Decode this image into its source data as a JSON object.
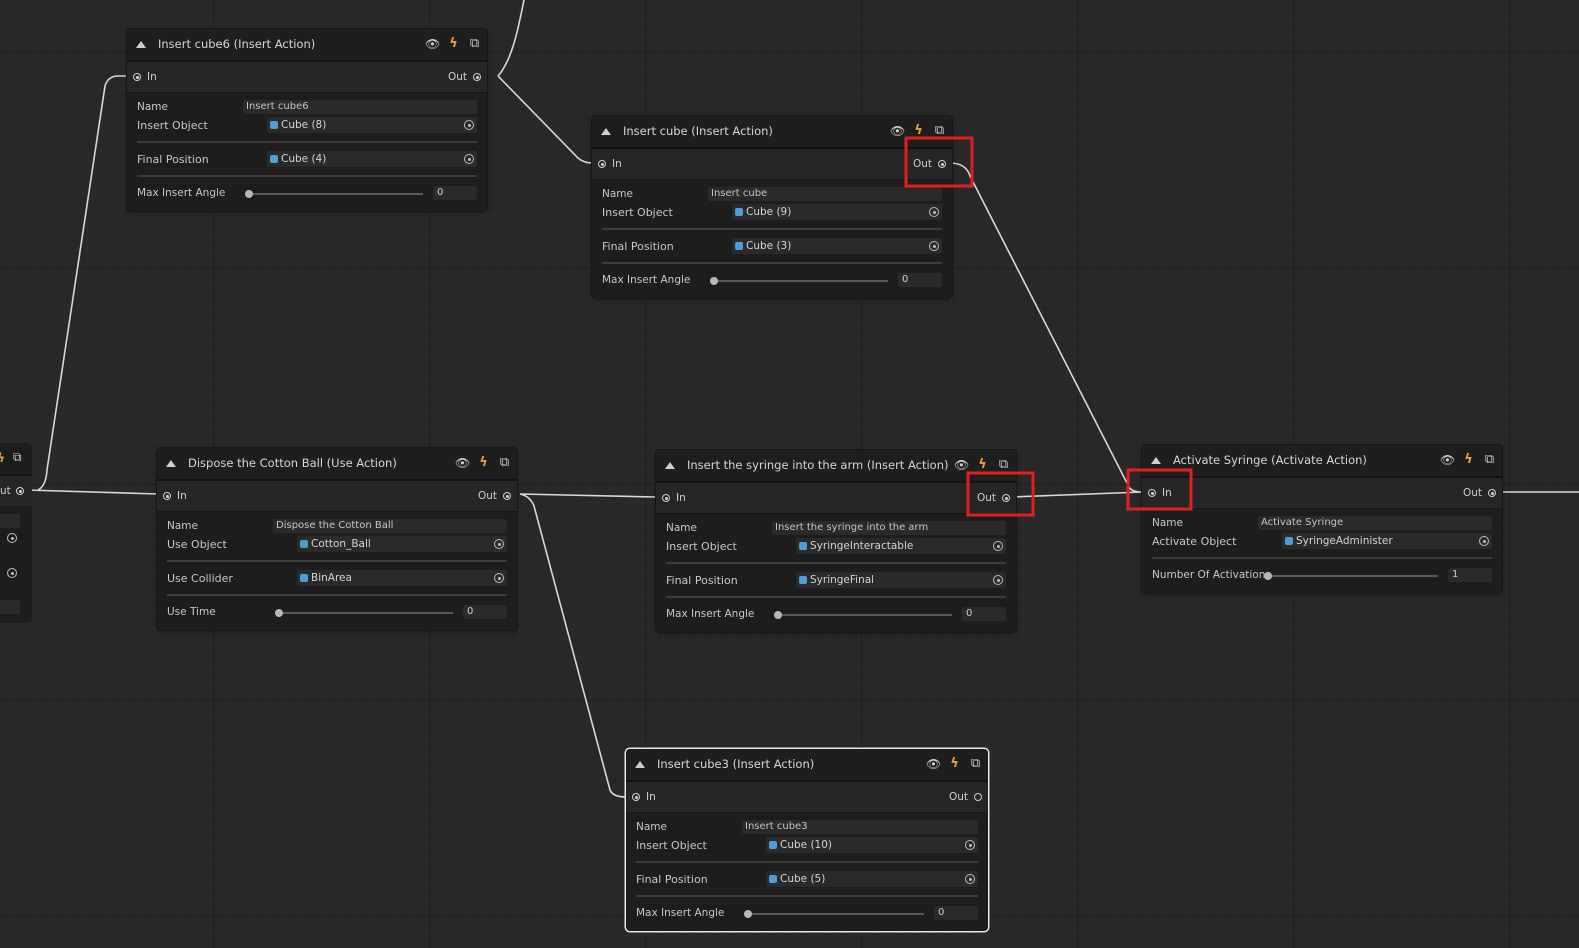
{
  "nodes": {
    "insert_cube6": {
      "title": "Insert cube6 (Insert Action)",
      "port_in": "In",
      "port_out": "Out",
      "name_label": "Name",
      "name_value": "Insert cube6",
      "object_label": "Insert Object",
      "object_value": "Cube (8)",
      "final_label": "Final Position",
      "final_value": "Cube (4)",
      "slider_label": "Max Insert Angle",
      "slider_value": "0"
    },
    "insert_cube": {
      "title": "Insert cube (Insert Action)",
      "port_in": "In",
      "port_out": "Out",
      "name_label": "Name",
      "name_value": "Insert cube",
      "object_label": "Insert Object",
      "object_value": "Cube (9)",
      "final_label": "Final Position",
      "final_value": "Cube (3)",
      "slider_label": "Max Insert Angle",
      "slider_value": "0"
    },
    "dispose_cotton": {
      "title": "Dispose the Cotton Ball (Use Action)",
      "port_in": "In",
      "port_out": "Out",
      "name_label": "Name",
      "name_value": "Dispose the Cotton Ball",
      "object_label": "Use Object",
      "object_value": "Cotton_Ball",
      "final_label": "Use Collider",
      "final_value": "BinArea",
      "slider_label": "Use Time",
      "slider_value": "0"
    },
    "insert_syringe": {
      "title": "Insert the syringe into the arm (Insert Action)",
      "port_in": "In",
      "port_out": "Out",
      "name_label": "Name",
      "name_value": "Insert the syringe into the arm",
      "object_label": "Insert Object",
      "object_value": "SyringeInteractable",
      "final_label": "Final Position",
      "final_value": "SyringeFinal",
      "slider_label": "Max Insert Angle",
      "slider_value": "0"
    },
    "activate_syringe": {
      "title": "Activate Syringe (Activate Action)",
      "port_in": "In",
      "port_out": "Out",
      "name_label": "Name",
      "name_value": "Activate Syringe",
      "object_label": "Activate Object",
      "object_value": "SyringeAdminister",
      "slider_label": "Number Of Activations",
      "slider_value": "1"
    },
    "insert_cube3": {
      "title": "Insert cube3 (Insert Action)",
      "port_in": "In",
      "port_out": "Out",
      "name_label": "Name",
      "name_value": "Insert cube3",
      "object_label": "Insert Object",
      "object_value": "Cube (10)",
      "final_label": "Final Position",
      "final_value": "Cube (5)",
      "slider_label": "Max Insert Angle",
      "slider_value": "0"
    }
  },
  "partial_node": {
    "port_out": "ut"
  },
  "icons": {
    "visibility": "eye-icon",
    "action": "lightning-icon",
    "settings": "node-settings-icon",
    "object": "cube-icon",
    "picker": "object-picker-icon"
  },
  "colors": {
    "canvas": "#282828",
    "node": "#1d1d1d",
    "wire": "#d8d8d8",
    "highlight": "#e02020",
    "bolt": "#e8a23a",
    "object_icon": "#4aa0d6"
  }
}
